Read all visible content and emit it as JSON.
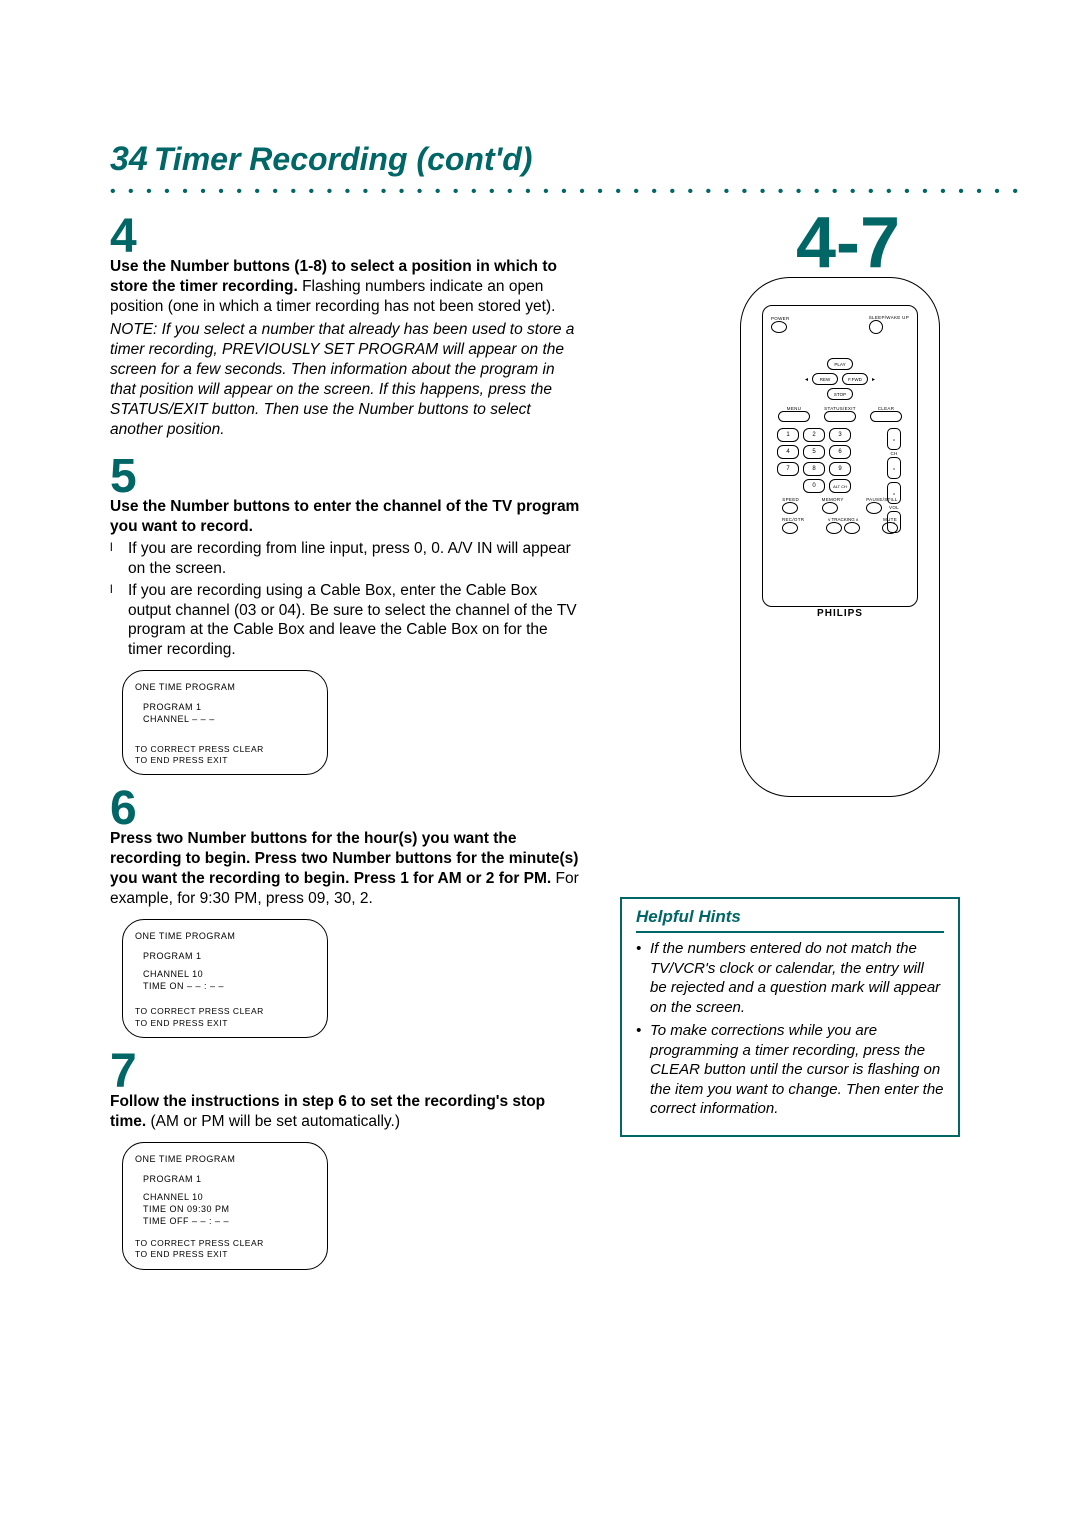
{
  "header": {
    "page_number": "34",
    "title": "Timer Recording (cont'd)"
  },
  "right_indicator": "4-7",
  "steps": {
    "s4": {
      "num": "4",
      "lead_bold": "Use the Number buttons (1-8) to select a position in which to store the timer recording.",
      "lead_rest": " Flashing numbers indicate an open position (one in which a timer recording has not been stored yet).",
      "note": "NOTE: If you select a number that already has been used to store a timer recording, PREVIOUSLY SET PROGRAM will appear on the screen for a few seconds. Then information about the program in that position will appear on the screen. If this happens, press the STATUS/EXIT button. Then use the Number buttons to select another position."
    },
    "s5": {
      "num": "5",
      "lead_bold": "Use the Number buttons to enter the channel of the TV program you want to record.",
      "bullets": [
        "If you are recording from line input, press 0, 0. A/V IN will appear on the screen.",
        "If you are recording using a Cable Box, enter the Cable Box output channel (03 or 04). Be sure to select the channel of the TV program at the Cable Box and leave the Cable Box on for the timer recording."
      ],
      "osd": {
        "title": "ONE TIME PROGRAM",
        "l1": "PROGRAM   1",
        "l2": "CHANNEL   – – –",
        "f1": "TO CORRECT PRESS CLEAR",
        "f2": "TO END PRESS EXIT"
      }
    },
    "s6": {
      "num": "6",
      "lead_bold": "Press two Number buttons for the hour(s) you want the recording to begin. Press two Number buttons for the minute(s) you want the recording to begin. Press 1 for AM or 2 for PM.",
      "lead_rest": " For example, for 9:30 PM, press 09, 30, 2.",
      "osd": {
        "title": "ONE TIME PROGRAM",
        "l1": "PROGRAM   1",
        "l2": "CHANNEL   10",
        "l3": "TIME ON     – – : – –",
        "f1": "TO CORRECT PRESS CLEAR",
        "f2": "TO END PRESS EXIT"
      }
    },
    "s7": {
      "num": "7",
      "lead_bold": "Follow the instructions in step 6 to set the recording's stop time.",
      "lead_rest": " (AM or PM will be set automatically.)",
      "osd": {
        "title": "ONE TIME PROGRAM",
        "l1": "PROGRAM   1",
        "l2": "CHANNEL   10",
        "l3": "TIME ON    09:30 PM",
        "l4": "TIME OFF    – – : – –",
        "f1": "TO CORRECT PRESS CLEAR",
        "f2": "TO END PRESS EXIT"
      }
    }
  },
  "hints": {
    "title": "Helpful Hints",
    "items": [
      "If the numbers entered do not match the TV/VCR's clock or calendar, the entry will be rejected and a question mark will appear on the screen.",
      "To make corrections while you are programming a timer recording, press the CLEAR button until the cursor is flashing on the item you want to change. Then enter the correct information."
    ]
  },
  "remote": {
    "brand": "PHILIPS",
    "labels": {
      "power": "POWER",
      "sleep": "SLEEP/WAKE UP",
      "play": "PLAY",
      "rew": "REW",
      "ffwd": "F.FWD",
      "stop": "STOP",
      "menu": "MENU",
      "status": "STATUS/EXIT",
      "clear": "CLEAR",
      "ch": "CH",
      "vol": "VOL",
      "altch": "ALT CH",
      "speed": "SPEED",
      "memory": "MEMORY",
      "pause": "PAUSE/STILL",
      "recotr": "REC/OTR",
      "tracking": "TRACKING",
      "mute": "MUTE"
    },
    "numbers": [
      "1",
      "2",
      "3",
      "4",
      "5",
      "6",
      "7",
      "8",
      "9",
      "0"
    ]
  }
}
